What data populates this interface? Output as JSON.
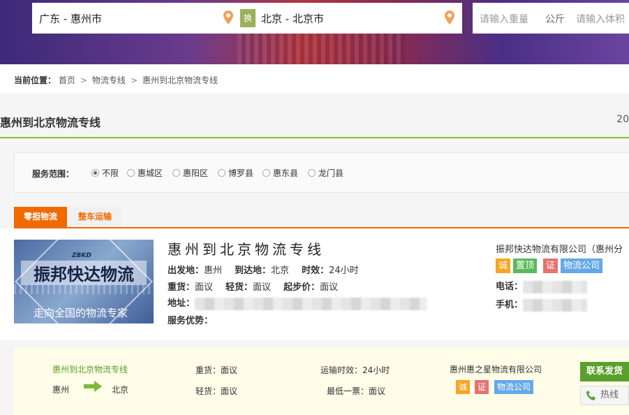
{
  "search": {
    "from_value": "广东 - 惠州市",
    "swap_label": "换",
    "to_value": "北京 - 北京市",
    "weight_placeholder": "请输入重量",
    "weight_unit": "公斤",
    "volume_placeholder": "请输入体积"
  },
  "breadcrumb": {
    "label": "当前位置：",
    "items": [
      "首页",
      "物流专线",
      "惠州到北京物流专线"
    ],
    "separator": ">"
  },
  "page": {
    "title": "惠州到北京物流专线",
    "right_text": "20"
  },
  "filter": {
    "label": "服务范围：",
    "options": [
      "不限",
      "惠城区",
      "惠阳区",
      "博罗县",
      "惠东县",
      "龙门县"
    ],
    "selected": "不限"
  },
  "tabs": [
    "零担物流",
    "整车运输"
  ],
  "listing": {
    "logo": {
      "abbr": "ZBKD",
      "brand": "振邦快达物流",
      "slogan": "走向全国的物流专家"
    },
    "title": "惠州到北京物流专线",
    "origin_label": "出发地：",
    "origin": "惠州",
    "dest_label": "到达地：",
    "dest": "北京",
    "time_label": "时效：",
    "time": "24小时",
    "heavy_label": "重货：",
    "heavy": "面议",
    "light_label": "轻货：",
    "light": "面议",
    "min_label": "起步价：",
    "min_price": "面议",
    "address_label": "地址：",
    "advantage_label": "服务优势：",
    "company": "振邦快达物流有限公司（惠州分",
    "badges": [
      "诚",
      "置顶",
      "证",
      "物流公司"
    ],
    "phone_label": "电话：",
    "mobile_label": "手机："
  },
  "second_listing": {
    "route_title": "惠州到北京物流专线",
    "from": "惠州",
    "to": "北京",
    "heavy": "重货：面议",
    "light": "轻货：面议",
    "transit": "运输时效：24小时",
    "min_ticket": "最低一票：面议",
    "company": "惠州惠之星物流有限公司",
    "badges": [
      "诚",
      "证",
      "物流公司"
    ],
    "contact_button": "联系发货",
    "hotline_button": "热线"
  },
  "colors": {
    "accent_orange": "#f06a00",
    "accent_green": "#8cbf35",
    "badge_orange": "#f5a623",
    "badge_green": "#5cb85c",
    "badge_red": "#e57373",
    "badge_blue": "#64a8e8"
  }
}
